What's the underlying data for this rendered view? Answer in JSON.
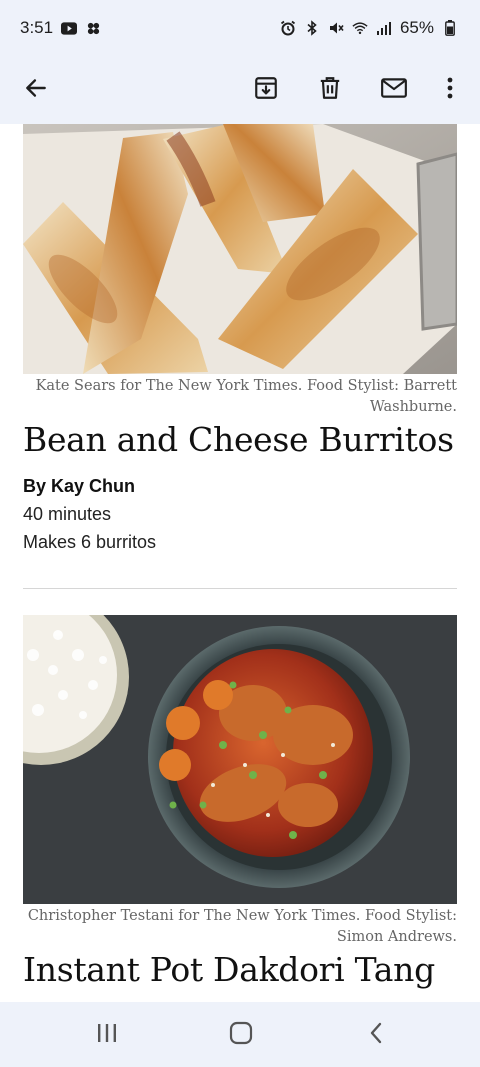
{
  "status_bar": {
    "time": "3:51",
    "battery": "65%",
    "left_icons": [
      "youtube-icon",
      "pinwheel-icon"
    ],
    "right_icons": [
      "alarm-icon",
      "bluetooth-icon",
      "mute-icon",
      "wifi-icon",
      "signal-icon",
      "battery-icon"
    ]
  },
  "app_bar": {
    "icons": [
      "back-arrow-icon",
      "archive-icon",
      "delete-icon",
      "mail-icon",
      "more-vert-icon"
    ]
  },
  "recipes": [
    {
      "photo_caption": "Kate Sears for The New York Times. Food Stylist: Barrett Washburne.",
      "title": "Bean and Cheese Burritos",
      "author": "By Kay Chun",
      "time": "40 minutes",
      "yield": "Makes 6 burritos"
    },
    {
      "photo_caption": "Christopher Testani for The New York Times. Food Stylist: Simon Andrews.",
      "title": "Instant Pot Dakdori Tang"
    }
  ],
  "nav_bar": {
    "icons": [
      "recents-icon",
      "home-icon",
      "back-icon"
    ]
  },
  "colors": {
    "chrome_background": "#eef2fa",
    "caption_text": "#666666",
    "divider": "#d6d6d6"
  }
}
